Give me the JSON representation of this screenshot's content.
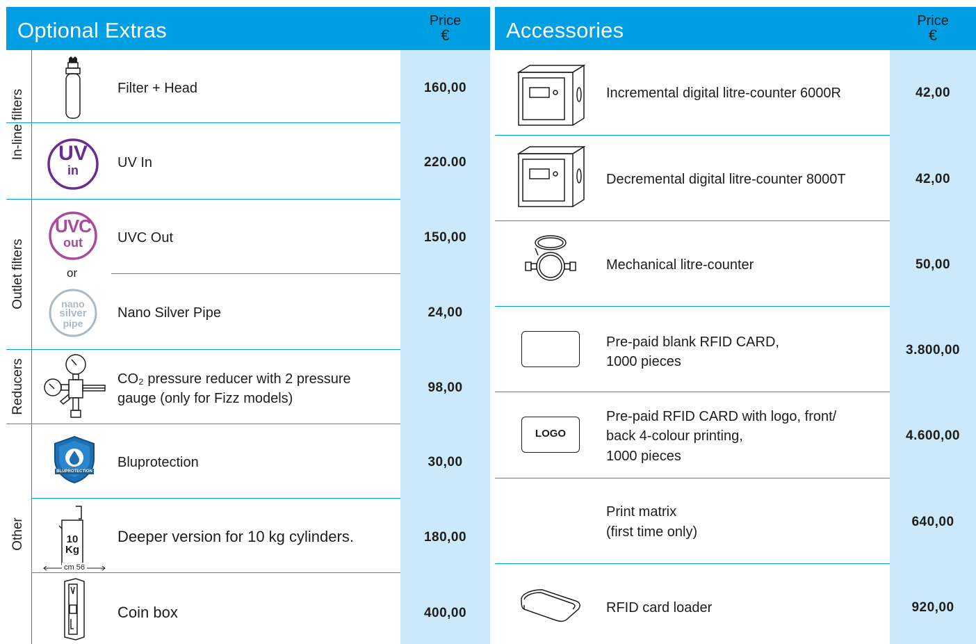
{
  "optional_extras": {
    "title": "Optional Extras",
    "price_label": "Price",
    "currency": "€",
    "groups": [
      {
        "label": "In-line filters"
      },
      {
        "label": "Outlet filters"
      },
      {
        "label": "Reducers"
      },
      {
        "label": "Other"
      }
    ],
    "or_label": "or",
    "items": [
      {
        "name": "Filter + Head",
        "price": "160,00",
        "icon": "filter-head-icon"
      },
      {
        "name": "UV In",
        "price": "220.00",
        "icon": "uv-in-icon",
        "icon_text": "UV",
        "icon_sub": "in"
      },
      {
        "name": "UVC Out",
        "price": "150,00",
        "icon": "uvc-out-icon",
        "icon_text": "UVC",
        "icon_sub": "out"
      },
      {
        "name": "Nano Silver Pipe",
        "price": "24,00",
        "icon": "nano-silver-pipe-icon",
        "icon_lines": [
          "nano",
          "silver",
          "pipe"
        ]
      },
      {
        "name_line1": "CO₂ pressure reducer with 2 pressure",
        "name_line2": "gauge (only for Fizz models)",
        "price": "98,00",
        "icon": "pressure-reducer-icon"
      },
      {
        "name": "Bluprotection",
        "price": "30,00",
        "icon": "bluprotection-shield-icon",
        "icon_text": "BLUPROTECTION"
      },
      {
        "name": "Deeper version for 10 kg cylinders.",
        "price": "180,00",
        "icon": "cylinder-10kg-icon",
        "icon_line1": "10",
        "icon_line2": "Kg",
        "icon_dim": "cm 56"
      },
      {
        "name": "Coin box",
        "price": "400,00",
        "icon": "coin-box-icon"
      }
    ]
  },
  "accessories": {
    "title": "Accessories",
    "price_label": "Price",
    "currency": "€",
    "items": [
      {
        "name": "Incremental digital litre-counter 6000R",
        "price": "42,00",
        "icon": "digital-counter-icon"
      },
      {
        "name": "Decremental digital litre-counter 8000T",
        "price": "42,00",
        "icon": "digital-counter-icon"
      },
      {
        "name": "Mechanical litre-counter",
        "price": "50,00",
        "icon": "mechanical-counter-icon"
      },
      {
        "name_line1": "Pre-paid blank RFID CARD,",
        "name_line2": "1000 pieces",
        "price": "3.800,00",
        "icon": "blank-card-icon"
      },
      {
        "name_line1": "Pre-paid RFID CARD with logo, front/",
        "name_line2": "back 4-colour printing,",
        "name_line3": "1000 pieces",
        "price": "4.600,00",
        "icon": "logo-card-icon",
        "icon_text": "LOGO"
      },
      {
        "name_line1": "Print matrix",
        "name_line2": "(first time only)",
        "price": "640,00"
      },
      {
        "name": "RFID card loader",
        "price": "920,00",
        "icon": "card-loader-icon"
      }
    ]
  },
  "colors": {
    "accent": "#009fe3",
    "price_bg": "#cce9f9",
    "uv_purple": "#6b2c91",
    "uvc_purple": "#a94a9c",
    "nano_grey": "#aab9c4",
    "shield_blue": "#1f6fb3"
  }
}
